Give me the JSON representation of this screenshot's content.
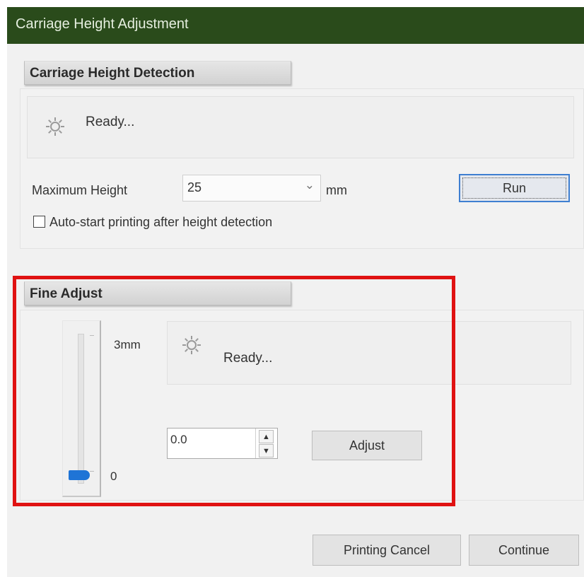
{
  "window": {
    "title": "Carriage Height Adjustment"
  },
  "detection": {
    "header": "Carriage Height Detection",
    "status": "Ready...",
    "status_icon": "gear-icon",
    "max_height_label": "Maximum Height",
    "max_height_value": "25",
    "unit": "mm",
    "run_label": "Run",
    "autostart_label": "Auto-start printing after height detection",
    "autostart_checked": false
  },
  "fine_adjust": {
    "header": "Fine Adjust",
    "slider_max_label": "3mm",
    "slider_min_label": "0",
    "slider_level": 0,
    "status": "Ready...",
    "status_icon": "gear-icon",
    "adjust_value": "0.0",
    "adjust_label": "Adjust"
  },
  "footer": {
    "printing_cancel_label": "Printing Cancel",
    "continue_label": "Continue"
  },
  "colors": {
    "titlebar": "#2a4b1b",
    "accent_focus": "#3f7fd1",
    "slider_thumb": "#1f74d6",
    "highlight_box": "#e01212"
  }
}
